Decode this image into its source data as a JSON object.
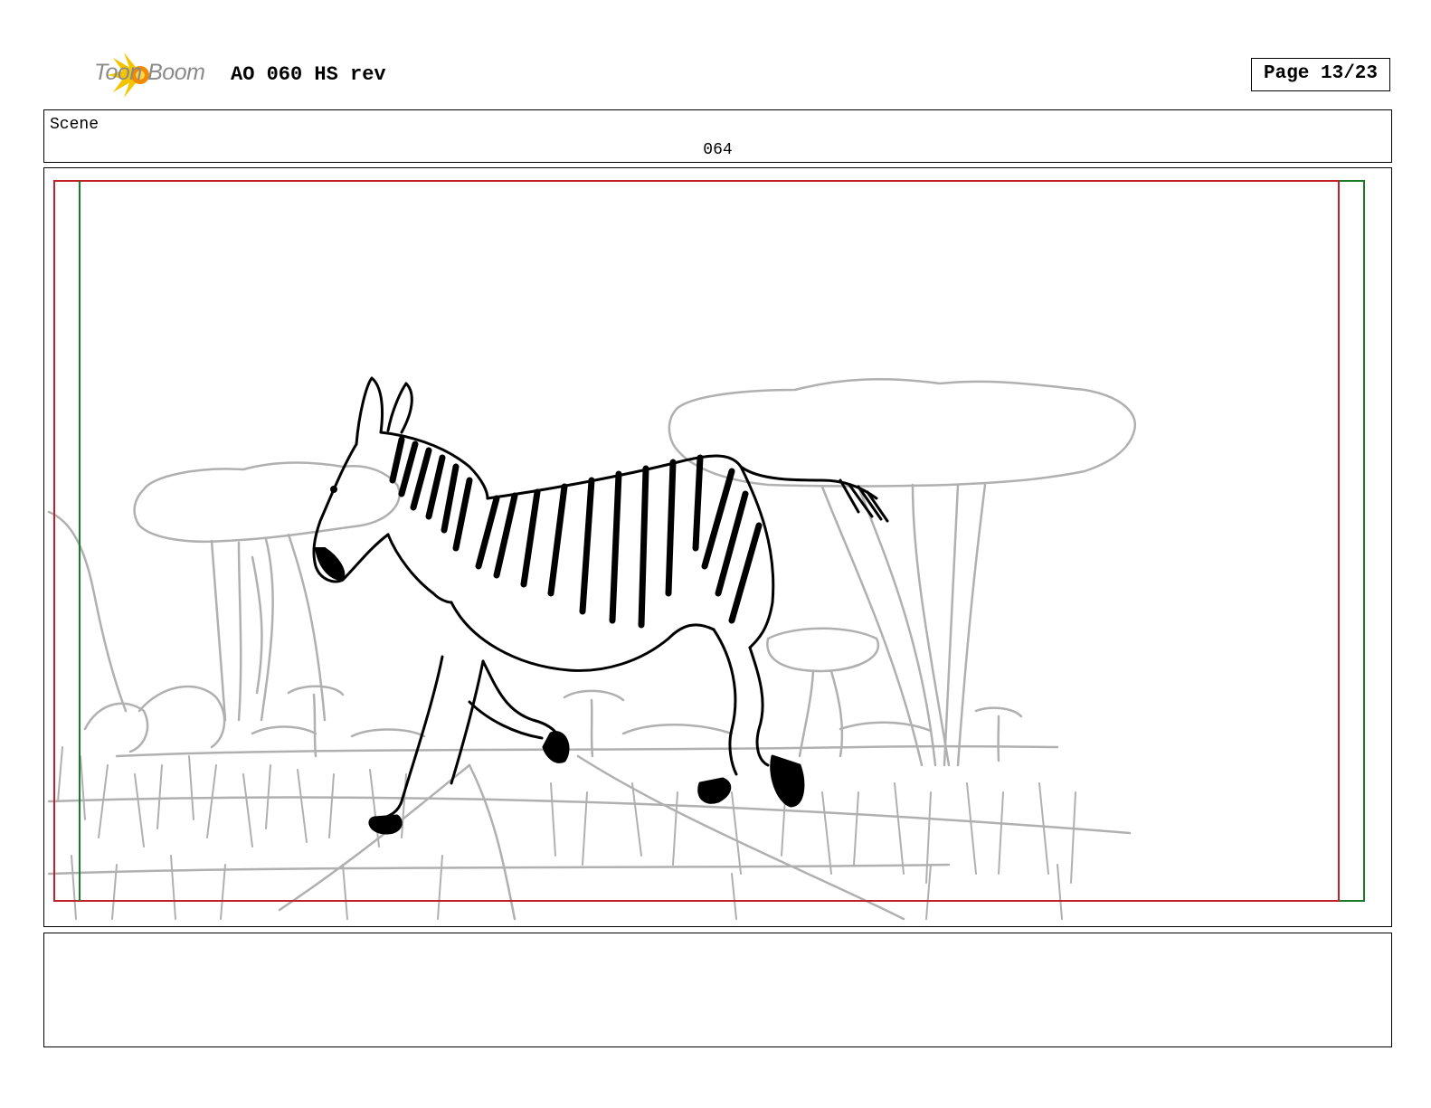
{
  "header": {
    "logo_text": "Toon Boom",
    "doc_title": "AO 060 HS rev",
    "page_label": "Page 13/23"
  },
  "scene": {
    "label": "Scene",
    "number": "064"
  },
  "panel": {
    "drawing_description_icon": "zebra-running-savanna-sketch"
  },
  "notes": {
    "text": ""
  },
  "colors": {
    "safe_frame": "#c0202a",
    "action_frame": "#1a7a2a",
    "sketch_gray": "#b0b0b0",
    "logo_yellow": "#f5c400",
    "logo_orange": "#f08a00"
  }
}
